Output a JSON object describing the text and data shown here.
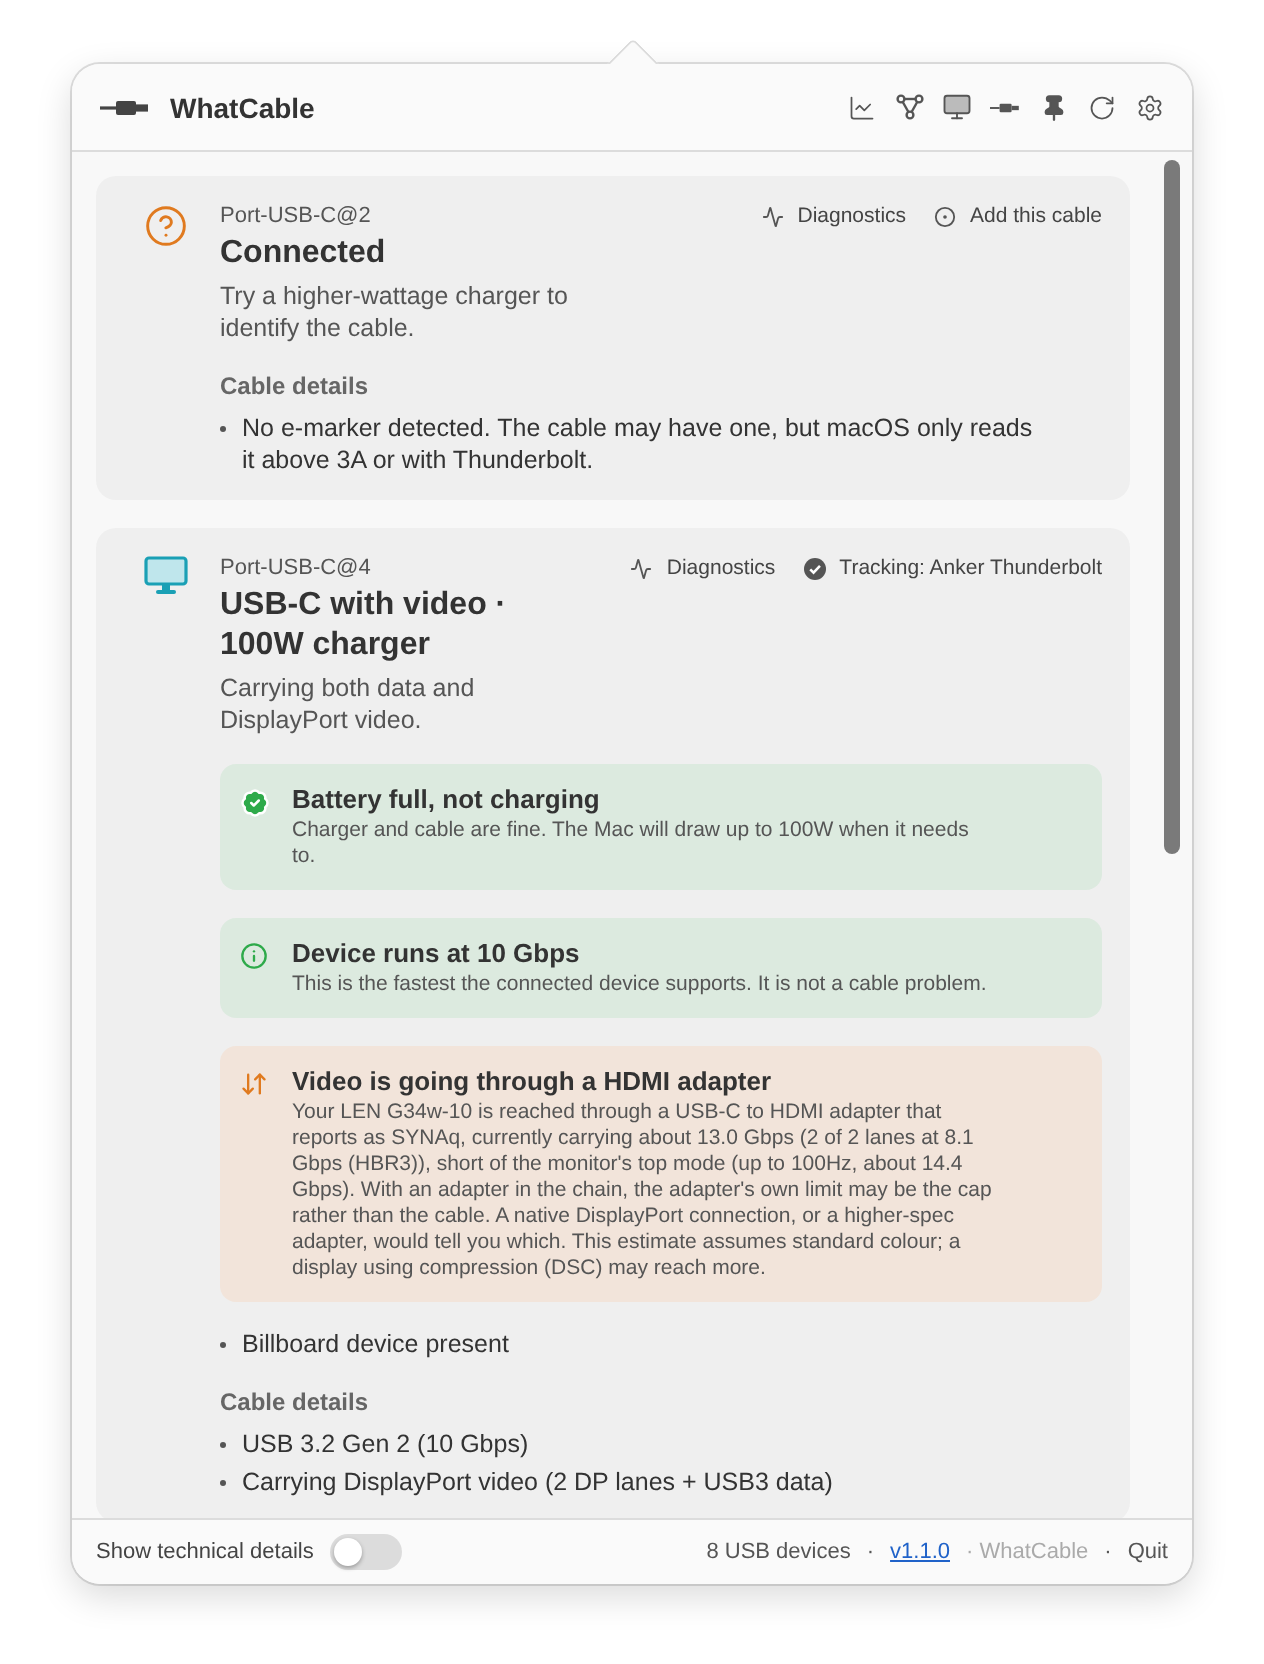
{
  "app": {
    "title": "WhatCable"
  },
  "ports": [
    {
      "kind": "question",
      "port": "Port-USB-C@2",
      "title": "Connected",
      "subtitle": "Try a higher-wattage charger to identify the cable.",
      "actions": [
        {
          "kind": "diagnostics",
          "label": "Diagnostics"
        },
        {
          "kind": "add",
          "label": "Add this cable"
        }
      ],
      "cable_details_heading": "Cable details",
      "cable_details": [
        "No e-marker detected. The cable may have one, but macOS only reads it above 3A or with Thunderbolt."
      ]
    },
    {
      "kind": "display",
      "port": "Port-USB-C@4",
      "title": "USB-C with video · 100W charger",
      "subtitle": "Carrying both data and DisplayPort video.",
      "actions": [
        {
          "kind": "diagnostics",
          "label": "Diagnostics"
        },
        {
          "kind": "tracking",
          "label": "Tracking: Anker Thunderbolt"
        }
      ],
      "alerts": [
        {
          "kind": "success",
          "title": "Battery full, not charging",
          "body": "Charger and cable are fine. The Mac will draw up to 100W when it needs to."
        },
        {
          "kind": "info",
          "title": "Device runs at 10 Gbps",
          "body": "This is the fastest the connected device supports. It is not a cable problem."
        },
        {
          "kind": "warning",
          "title": "Video is going through a HDMI adapter",
          "body": "Your LEN G34w-10 is reached through a USB-C to HDMI adapter that reports as SYNAq, currently carrying about 13.0 Gbps (2 of 2 lanes at 8.1 Gbps (HBR3)), short of the monitor's top mode (up to 100Hz, about 14.4 Gbps). With an adapter in the chain, the adapter's own limit may be the cap rather than the cable. A native DisplayPort connection, or a higher-spec adapter, would tell you which. This estimate assumes standard colour; a display using compression (DSC) may reach more."
        }
      ],
      "notes": [
        "Billboard device present"
      ],
      "cable_details_heading": "Cable details",
      "cable_details": [
        "USB 3.2 Gen 2 (10 Gbps)",
        "Carrying DisplayPort video (2 DP lanes + USB3 data)"
      ]
    }
  ],
  "footer": {
    "toggle_label": "Show technical details",
    "toggle_on": false,
    "items": [
      {
        "kind": "text",
        "text": "8 USB devices"
      },
      {
        "kind": "separator",
        "text": "·"
      },
      {
        "kind": "link",
        "text": "v1.1.0"
      },
      {
        "kind": "muted",
        "text": "· WhatCable"
      },
      {
        "kind": "separator",
        "text": "·"
      },
      {
        "kind": "button",
        "text": "Quit"
      }
    ]
  }
}
